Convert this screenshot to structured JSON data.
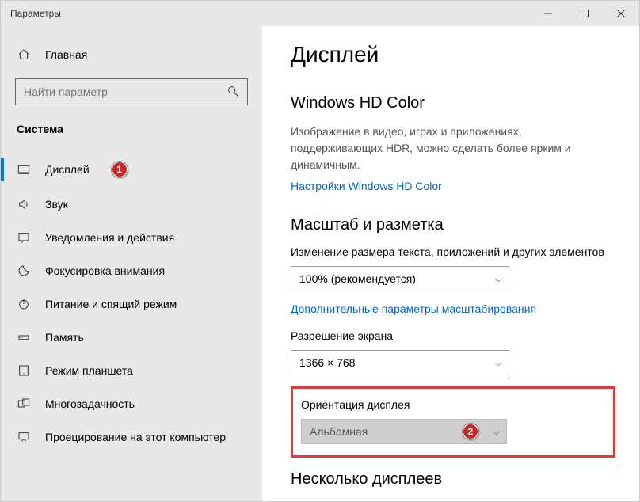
{
  "titlebar": {
    "title": "Параметры"
  },
  "sidebar": {
    "home": "Главная",
    "search_placeholder": "Найти параметр",
    "section": "Система",
    "items": [
      {
        "label": "Дисплей"
      },
      {
        "label": "Звук"
      },
      {
        "label": "Уведомления и действия"
      },
      {
        "label": "Фокусировка внимания"
      },
      {
        "label": "Питание и спящий режим"
      },
      {
        "label": "Память"
      },
      {
        "label": "Режим планшета"
      },
      {
        "label": "Многозадачность"
      },
      {
        "label": "Проецирование на этот компьютер"
      }
    ]
  },
  "markers": {
    "one": "1",
    "two": "2"
  },
  "content": {
    "page_title": "Дисплей",
    "hd": {
      "heading": "Windows HD Color",
      "desc": "Изображение в видео, играх и приложениях, поддерживающих HDR, можно сделать более ярким и динамичным.",
      "link": "Настройки Windows HD Color"
    },
    "scale": {
      "heading": "Масштаб и разметка",
      "size_label": "Изменение размера текста, приложений и других элементов",
      "size_value": "100% (рекомендуется)",
      "adv_link": "Дополнительные параметры масштабирования",
      "res_label": "Разрешение экрана",
      "res_value": "1366 × 768",
      "orient_label": "Ориентация дисплея",
      "orient_value": "Альбомная"
    },
    "multi_heading": "Несколько дисплеев"
  }
}
